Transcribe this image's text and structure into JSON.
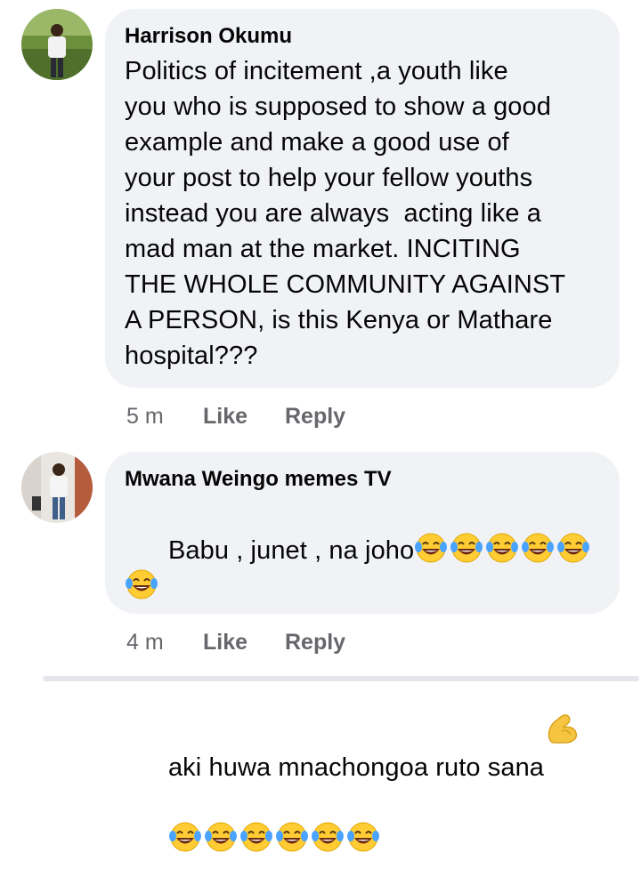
{
  "comments": [
    {
      "author": "Harrison Okumu",
      "text": "Politics of incitement ,a youth like\nyou who is supposed to show a good\nexample and make a good use of\nyour post to help your fellow youths\ninstead you are always  acting like a\nmad man at the market. INCITING\nTHE WHOLE COMMUNITY AGAINST\nA PERSON, is this Kenya or Mathare\nhospital???",
      "time": "5 m",
      "like_label": "Like",
      "reply_label": "Reply"
    },
    {
      "author": "Mwana Weingo memes TV",
      "line1": "Babu , junet , na joho",
      "line2": "aki huwa mnachongoa ruto sana",
      "time": "4 m",
      "like_label": "Like",
      "reply_label": "Reply",
      "emoji_laugh": "face-with-tears-of-joy-icon",
      "emoji_flex": "flexed-biceps-icon"
    }
  ],
  "colors": {
    "bubble": "#f0f2f5",
    "meta": "#65676b",
    "text": "#050505"
  }
}
